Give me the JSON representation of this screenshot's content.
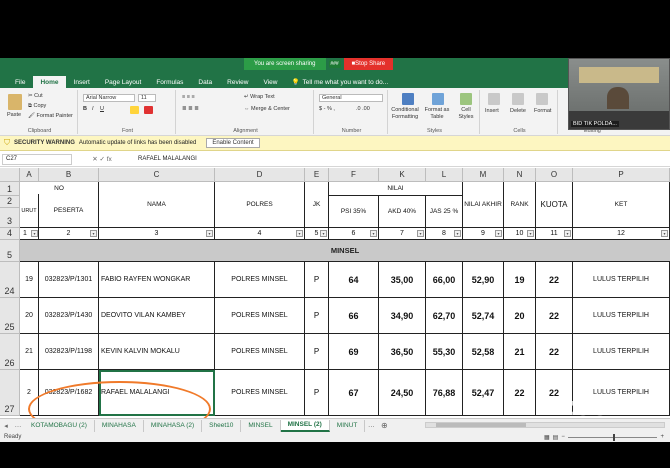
{
  "share_bar": {
    "status": "You are screen sharing",
    "badge": "###",
    "stop_label": "Stop Share"
  },
  "zoom_panel": {
    "label": "BID TIK POLDA..."
  },
  "ribbon_tabs": [
    "File",
    "Home",
    "Insert",
    "Page Layout",
    "Formulas",
    "Data",
    "Review",
    "View"
  ],
  "tell_me": "Tell me what you want to do...",
  "ribbon": {
    "clipboard": {
      "paste": "Paste",
      "cut": "Cut",
      "copy": "Copy",
      "format_painter": "Format Painter",
      "label": "Clipboard"
    },
    "font": {
      "name": "Arial Narrow",
      "size": "11",
      "label": "Font"
    },
    "alignment": {
      "wrap": "Wrap Text",
      "merge": "Merge & Center",
      "label": "Alignment"
    },
    "number": {
      "format": "General",
      "label": "Number"
    },
    "styles": {
      "conditional": "Conditional Formatting",
      "format_table": "Format as Table",
      "cell_styles": "Cell Styles",
      "label": "Styles"
    },
    "cells": {
      "insert": "Insert",
      "delete": "Delete",
      "format": "Format",
      "label": "Cells"
    },
    "editing": {
      "auto": "Au",
      "label": "Editing"
    }
  },
  "security": {
    "title": "SECURITY WARNING",
    "message": "Automatic update of links has been disabled",
    "button": "Enable Content"
  },
  "formula_bar": {
    "cell_ref": "C27",
    "fx": "✕ ✓ fx",
    "value": "RAFAEL MALALANGI"
  },
  "columns": [
    "A",
    "B",
    "C",
    "D",
    "E",
    "F",
    "K",
    "L",
    "M",
    "N",
    "O",
    "P"
  ],
  "header": {
    "no": "NO",
    "urut": "URUT",
    "peserta": "PESERTA",
    "nama": "NAMA",
    "polres": "POLRES",
    "jk": "JK",
    "nilai": "NILAI",
    "psi": "PSI 35%",
    "akd": "AKD 40%",
    "jas": "JAS 25 %",
    "nilai_akhir": "NILAI AKHIR",
    "rank": "RANK",
    "kuota": "KUOTA",
    "ket": "KET"
  },
  "header_numbers": [
    "1",
    "2",
    "3",
    "4",
    "5",
    "6",
    "7",
    "8",
    "9",
    "10",
    "11",
    "12"
  ],
  "row_numbers": [
    "1",
    "2",
    "3",
    "4",
    "5",
    "24",
    "25",
    "26",
    "27"
  ],
  "section_label": "MINSEL",
  "rows": [
    {
      "urut": "19",
      "peserta": "032823/P/1301",
      "nama": "FABIO RAYFEN WONGKAR",
      "polres": "POLRES MINSEL",
      "jk": "P",
      "psi": "64",
      "akd": "35,00",
      "jas": "66,00",
      "akhir": "52,90",
      "rank": "19",
      "kuota": "22",
      "ket": "LULUS TERPILIH"
    },
    {
      "urut": "20",
      "peserta": "032823/P/1430",
      "nama": "DEOVITO VILAN KAMBEY",
      "polres": "POLRES MINSEL",
      "jk": "P",
      "psi": "66",
      "akd": "34,90",
      "jas": "62,70",
      "akhir": "52,74",
      "rank": "20",
      "kuota": "22",
      "ket": "LULUS TERPILIH"
    },
    {
      "urut": "21",
      "peserta": "032823/P/1198",
      "nama": "KEVIN KALVIN MOKALU",
      "polres": "POLRES MINSEL",
      "jk": "P",
      "psi": "69",
      "akd": "36,50",
      "jas": "55,30",
      "akhir": "52,58",
      "rank": "21",
      "kuota": "22",
      "ket": "LULUS TERPILIH"
    },
    {
      "urut": "2",
      "peserta": "032823/P/1682",
      "nama": "RAFAEL MALALANGI",
      "polres": "POLRES MINSEL",
      "jk": "P",
      "psi": "67",
      "akd": "24,50",
      "jas": "76,88",
      "akhir": "52,47",
      "rank": "22",
      "kuota": "22",
      "ket": "LULUS TERPILIH"
    }
  ],
  "sheet_tabs": [
    "KOTAMOBAGU (2)",
    "MINAHASA",
    "MINAHASA (2)",
    "Sheet10",
    "MINSEL",
    "MINSEL (2)",
    "MINUT"
  ],
  "active_sheet": "MINSEL (2)",
  "status": {
    "ready": "Ready"
  },
  "watermark": "zoom",
  "colors": {
    "excel_green": "#217346",
    "share_green": "#2c9c47",
    "share_red": "#e4312b",
    "annotation": "#f07a2a",
    "section_gray": "#c9c9c9"
  }
}
